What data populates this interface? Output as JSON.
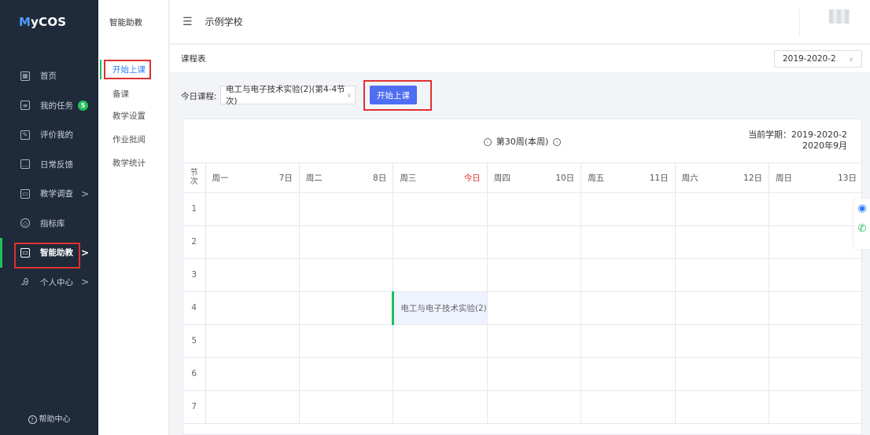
{
  "brand": {
    "logo_m": "M",
    "logo_rest": "yCOS"
  },
  "sidebar": {
    "items": [
      {
        "label": "首页",
        "icon": "grid-icon"
      },
      {
        "label": "我的任务",
        "icon": "task-icon",
        "badge": "5"
      },
      {
        "label": "评价我的",
        "icon": "evaluate-icon"
      },
      {
        "label": "日常反馈",
        "icon": "feedback-icon"
      },
      {
        "label": "教学调查",
        "icon": "survey-icon",
        "arrow": ">"
      },
      {
        "label": "指标库",
        "icon": "cube-icon"
      },
      {
        "label": "智能助教",
        "icon": "assistant-icon",
        "arrow": ">"
      },
      {
        "label": "个人中心",
        "icon": "user-icon",
        "arrow": ">"
      }
    ],
    "help": "帮助中心"
  },
  "subpanel": {
    "title": "智能助教",
    "items": [
      "开始上课",
      "备课",
      "教学设置",
      "作业批阅",
      "教学统计"
    ]
  },
  "header": {
    "school": "示例学校"
  },
  "content": {
    "title": "课程表",
    "term_select": "2019-2020-2",
    "today_label": "今日课程:",
    "course_select": "电工与电子技术实验(2)(第4-4节次)",
    "start_button": "开始上课",
    "week_label": "第30周(本周)",
    "term_info_line1": "当前学期：2019-2020-2",
    "term_info_line2": "2020年9月"
  },
  "timetable": {
    "jc_header": "节次",
    "days": [
      {
        "name": "周一",
        "date": "7日"
      },
      {
        "name": "周二",
        "date": "8日"
      },
      {
        "name": "周三",
        "date": "今日"
      },
      {
        "name": "周四",
        "date": "10日"
      },
      {
        "name": "周五",
        "date": "11日"
      },
      {
        "name": "周六",
        "date": "12日"
      },
      {
        "name": "周日",
        "date": "13日"
      }
    ],
    "rows": [
      "1",
      "2",
      "3",
      "4",
      "5",
      "6",
      "7"
    ],
    "course": {
      "row": 4,
      "day": "周三",
      "name": "电工与电子技术实验(2)"
    }
  },
  "colors": {
    "accent": "#4e6ef2",
    "sidebar_bg": "#1f2a3a",
    "active_green": "#1fbf5a",
    "highlight_red": "#e03131"
  }
}
